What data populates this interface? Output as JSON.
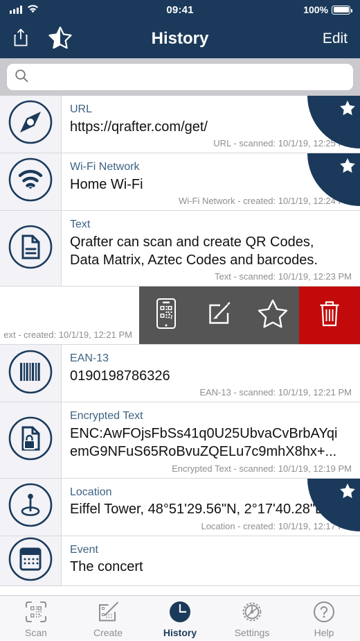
{
  "status_bar": {
    "time": "09:41",
    "battery_percent": "100%",
    "signal_icon": "cellular-signal-icon",
    "wifi_icon": "wifi-icon",
    "battery_icon": "battery-full-icon"
  },
  "nav_bar": {
    "title": "History",
    "share_icon": "share-icon",
    "favorites_icon": "star-half-icon",
    "edit_label": "Edit"
  },
  "search": {
    "value": "",
    "placeholder": "",
    "icon": "search-icon"
  },
  "colors": {
    "navy": "#1b3a5b",
    "type_label": "#3c6283",
    "meta_gray": "#8e8e93",
    "swipe_gray": "#555556",
    "delete_red": "#c20a0a",
    "icon_column": "#f2f2f7"
  },
  "list": {
    "rows": [
      {
        "icon": "compass-icon",
        "type": "URL",
        "value": "https://qrafter.com/get/",
        "meta": "URL - scanned: 10/1/19, 12:25 PM",
        "favorite": true
      },
      {
        "icon": "wifi-network-icon",
        "type": "Wi-Fi Network",
        "value": "Home Wi-Fi",
        "meta": "Wi-Fi Network - created: 10/1/19, 12:24 PM",
        "favorite": true
      },
      {
        "icon": "document-text-icon",
        "type": "Text",
        "value": "Qrafter can scan and create QR Codes,\nData Matrix, Aztec Codes and barcodes.",
        "meta": "Text - scanned: 10/1/19, 12:23 PM",
        "favorite": false
      },
      {
        "icon": "barcode-icon",
        "type": "EAN-13",
        "value": "0190198786326",
        "meta": "EAN-13 - scanned: 10/1/19, 12:21 PM",
        "favorite": false
      },
      {
        "icon": "document-lock-icon",
        "type": "Encrypted Text",
        "value": "ENC:AwFOjsFbSs41q0U25UbvaCvBrbAYqi\nemG9NFuS65RoBvuZQELu7c9mhX8hx+...",
        "meta": "Encrypted Text - scanned: 10/1/19, 12:19 PM",
        "favorite": false
      },
      {
        "icon": "location-pin-icon",
        "type": "Location",
        "value": "Eiffel Tower, 48°51'29.56\"N, 2°17'40.28\"E",
        "meta": "Location - created: 10/1/19, 12:17 PM",
        "favorite": true
      },
      {
        "icon": "calendar-icon",
        "type": "Event",
        "value": "The concert",
        "meta": "",
        "favorite": false
      }
    ],
    "swiped_row": {
      "meta": "ext - created: 10/1/19, 12:21 PM",
      "actions": [
        {
          "name": "show-code-action",
          "icon": "phone-qr-icon",
          "style": "gray"
        },
        {
          "name": "edit-action",
          "icon": "edit-pencil-icon",
          "style": "gray"
        },
        {
          "name": "favorite-action",
          "icon": "star-outline-icon",
          "style": "gray"
        },
        {
          "name": "delete-action",
          "icon": "trash-icon",
          "style": "red"
        }
      ]
    }
  },
  "tab_bar": {
    "tabs": [
      {
        "label": "Scan",
        "icon": "scan-qr-icon",
        "active": false
      },
      {
        "label": "Create",
        "icon": "create-qr-icon",
        "active": false
      },
      {
        "label": "History",
        "icon": "clock-icon",
        "active": true
      },
      {
        "label": "Settings",
        "icon": "gear-icon",
        "active": false
      },
      {
        "label": "Help",
        "icon": "question-circle-icon",
        "active": false
      }
    ]
  }
}
